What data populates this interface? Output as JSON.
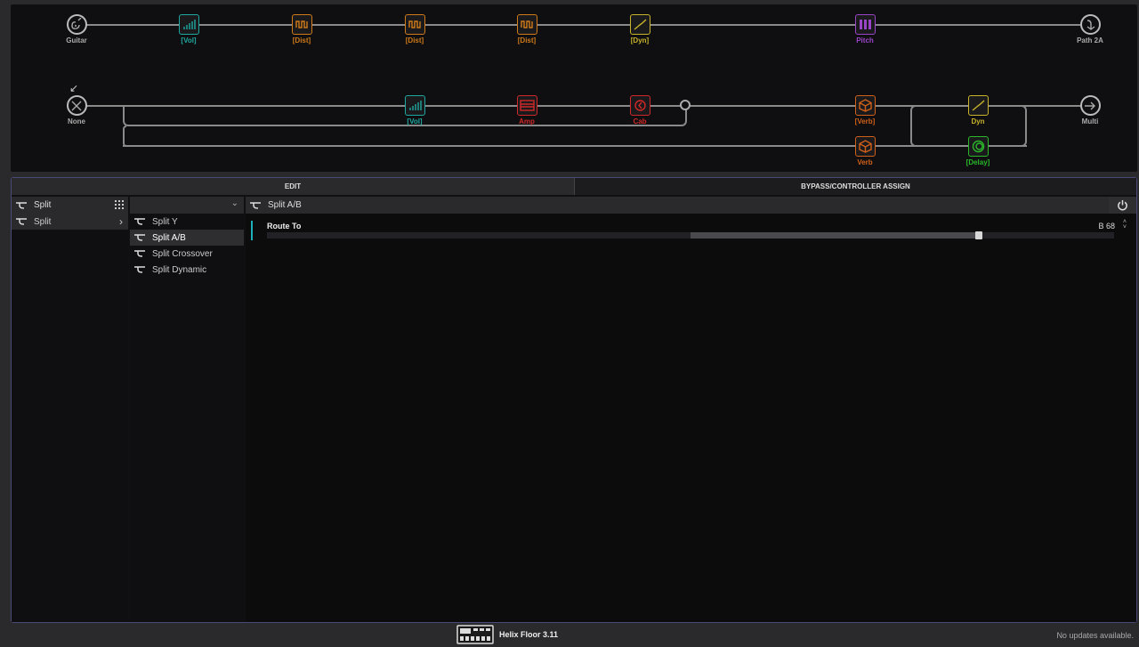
{
  "signal_path": {
    "path1": [
      {
        "label": "Guitar",
        "color": "#aaaaaa",
        "icon": "guitar-input-icon"
      },
      {
        "label": "[Vol]",
        "color": "#1fa8a0",
        "icon": "volume-bars-icon"
      },
      {
        "label": "[Dist]",
        "color": "#d07a1a",
        "icon": "distortion-wave-icon"
      },
      {
        "label": "[Dist]",
        "color": "#d07a1a",
        "icon": "distortion-wave-icon"
      },
      {
        "label": "[Dist]",
        "color": "#d07a1a",
        "icon": "distortion-wave-icon"
      },
      {
        "label": "[Dyn]",
        "color": "#c8b42a",
        "icon": "dynamics-curve-icon"
      },
      {
        "label": "Pitch",
        "color": "#9a45c8",
        "icon": "pitch-keys-icon"
      },
      {
        "label": "Path 2A",
        "color": "#aaaaaa",
        "icon": "path-output-icon"
      }
    ],
    "path2": [
      {
        "label": "None",
        "color": "#aaaaaa",
        "icon": "no-input-icon"
      },
      {
        "label": "[Vol]",
        "color": "#1fa8a0",
        "icon": "volume-bars-icon"
      },
      {
        "label": "Amp",
        "color": "#d02828",
        "icon": "amp-icon"
      },
      {
        "label": "Cab",
        "color": "#d02828",
        "icon": "cab-speaker-icon"
      },
      {
        "label": "[Verb]",
        "color": "#d0601a",
        "icon": "reverb-cube-icon"
      },
      {
        "label": "Dyn",
        "color": "#c8b42a",
        "icon": "dynamics-curve-icon"
      },
      {
        "label": "Multi",
        "color": "#aaaaaa",
        "icon": "multi-output-icon"
      }
    ],
    "path2b": [
      {
        "label": "Verb",
        "color": "#d0601a",
        "icon": "reverb-cube-icon"
      },
      {
        "label": "[Delay]",
        "color": "#2ab82a",
        "icon": "delay-circle-icon"
      }
    ]
  },
  "tabs": {
    "edit": "EDIT",
    "bypass": "BYPASS/CONTROLLER ASSIGN"
  },
  "categories": {
    "header": "Split",
    "items": [
      {
        "label": "Split"
      }
    ]
  },
  "models": {
    "items": [
      {
        "label": "Split Y"
      },
      {
        "label": "Split A/B"
      },
      {
        "label": "Split Crossover"
      },
      {
        "label": "Split Dynamic"
      }
    ]
  },
  "params": {
    "title": "Split A/B",
    "route_to_label": "Route To",
    "route_to_value": "B 68",
    "route_to_level": 0.84
  },
  "footer": {
    "device": "Helix Floor 3.11",
    "status": "No updates available."
  }
}
